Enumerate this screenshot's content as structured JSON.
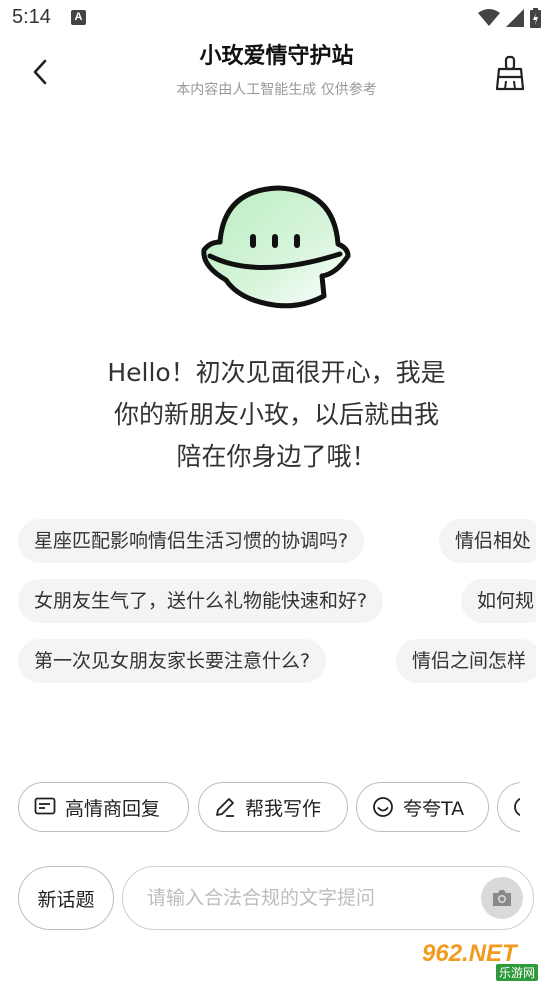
{
  "status_bar": {
    "time": "5:14",
    "notification_letter": "A",
    "icons": [
      "wifi-icon",
      "signal-icon",
      "battery-charging-icon"
    ]
  },
  "header": {
    "title": "小玫爱情守护站",
    "subtitle": "本内容由人工智能生成 仅供参考",
    "back_icon": "chevron-left-icon",
    "clear_icon": "broom-icon"
  },
  "mascot": {
    "icon": "green-helmet-mascot",
    "color": "#9fe3a8"
  },
  "greeting": {
    "line1": "Hello！初次见面很开心，我是",
    "line2": "你的新朋友小玫，以后就由我",
    "line3": "陪在你身边了哦！"
  },
  "suggestions": {
    "row1": [
      "星座匹配影响情侣生活习惯的协调吗?",
      "情侣相处"
    ],
    "row2": [
      "女朋友生气了，送什么礼物能快速和好?",
      "如何规"
    ],
    "row3": [
      "第一次见女朋友家长要注意什么?",
      "情侣之间怎样"
    ]
  },
  "tools": [
    {
      "label": "高情商回复",
      "icon": "chat-box-icon"
    },
    {
      "label": "帮我写作",
      "icon": "pen-icon"
    },
    {
      "label": "夸夸TA",
      "icon": "smile-icon"
    }
  ],
  "composer": {
    "new_topic_label": "新话题",
    "placeholder": "请输入合法合规的文字提问",
    "camera_icon": "camera-icon"
  },
  "watermark": {
    "main": "962.NET",
    "sub": "乐游网"
  }
}
